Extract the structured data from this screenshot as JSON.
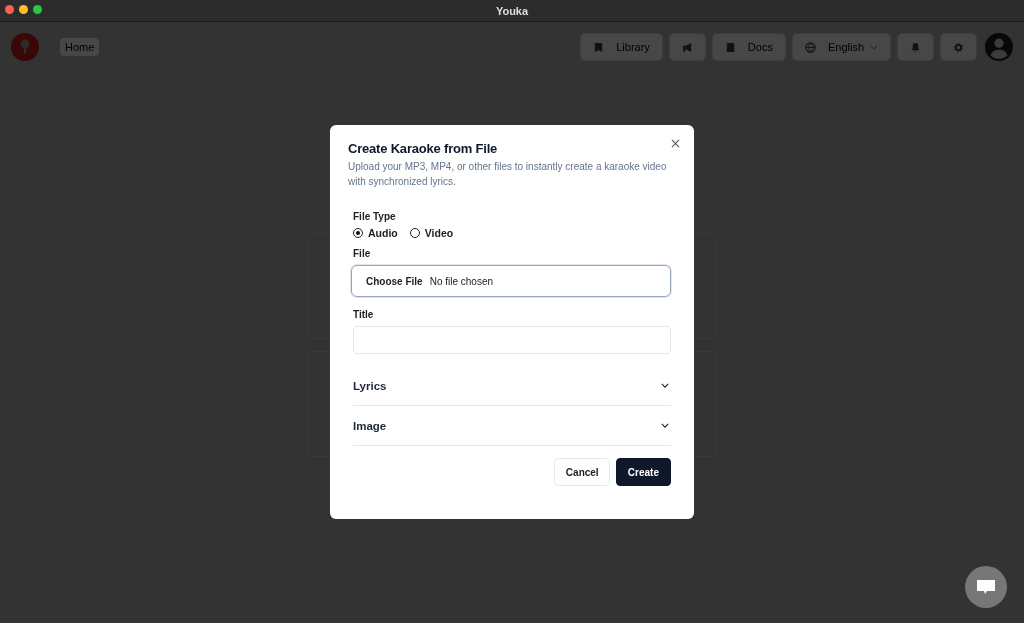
{
  "window": {
    "title": "Youka"
  },
  "nav": {
    "home": "Home",
    "items": [
      {
        "kind": "library",
        "label": "Library"
      },
      {
        "kind": "announce"
      },
      {
        "kind": "docs",
        "label": "Docs"
      },
      {
        "kind": "language",
        "label": "English"
      },
      {
        "kind": "bell"
      },
      {
        "kind": "settings"
      }
    ]
  },
  "dialog": {
    "title": "Create Karaoke from File",
    "description": "Upload your MP3, MP4, or other files to instantly create a karaoke video with synchronized lyrics.",
    "file_type": {
      "label": "File Type",
      "options": [
        {
          "label": "Audio",
          "selected": true
        },
        {
          "label": "Video",
          "selected": false
        }
      ]
    },
    "file": {
      "label": "File",
      "button": "Choose File",
      "status": "No file chosen"
    },
    "title_field": {
      "label": "Title"
    },
    "sections": [
      {
        "label": "Lyrics",
        "expanded": false
      },
      {
        "label": "Image",
        "expanded": false
      }
    ],
    "buttons": [
      {
        "kind": "secondary",
        "label": "Cancel"
      },
      {
        "kind": "primary",
        "label": "Create"
      }
    ]
  }
}
